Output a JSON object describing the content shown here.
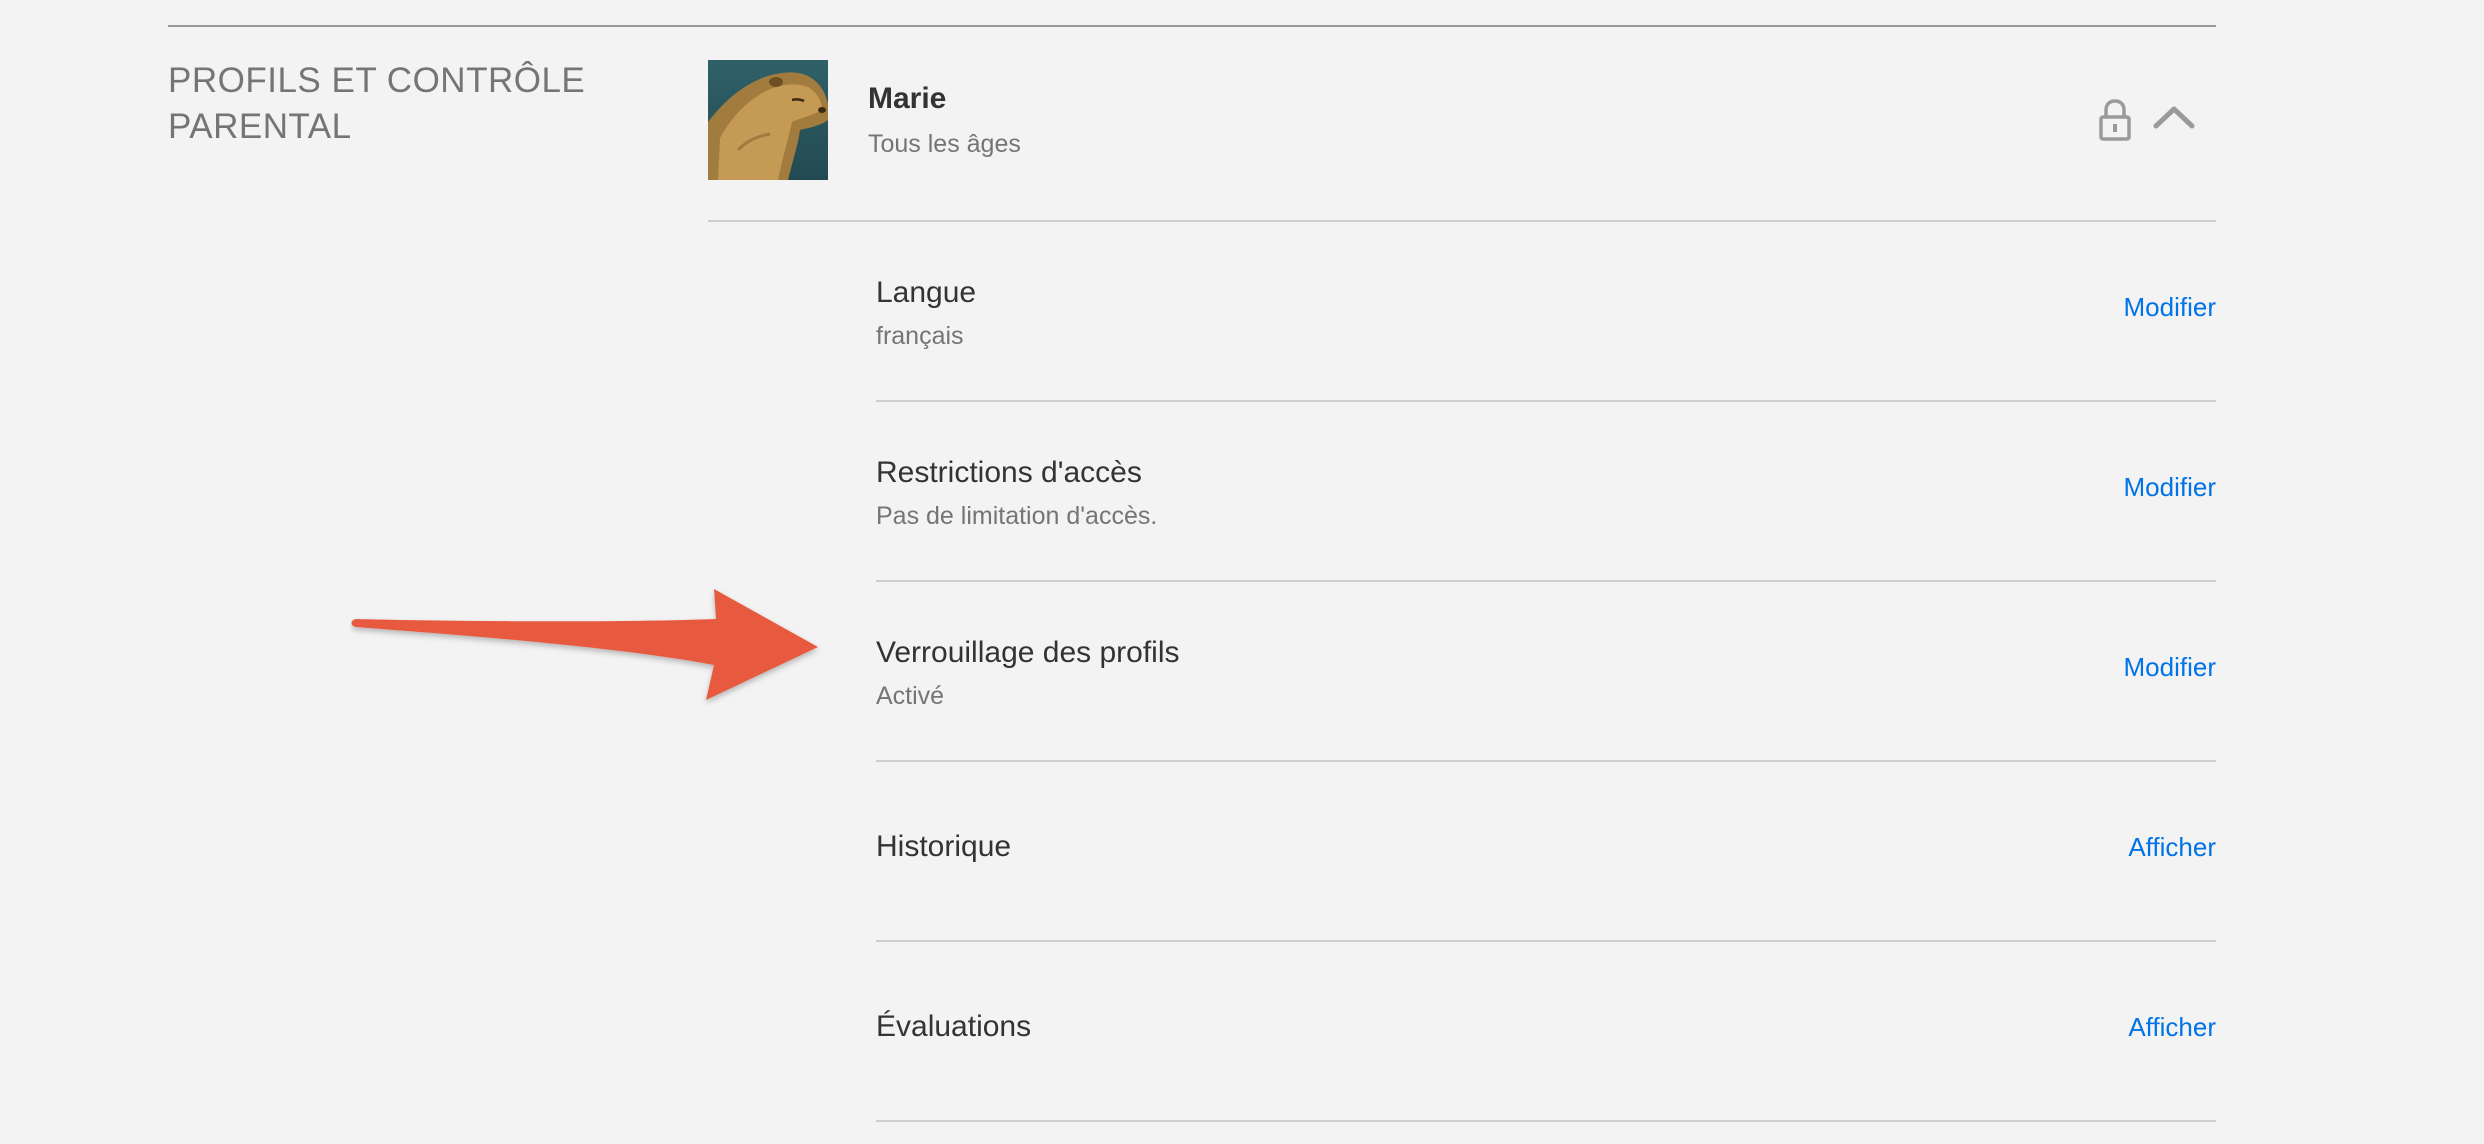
{
  "section": {
    "title": "PROFILS ET CONTRÔLE PARENTAL"
  },
  "profile": {
    "name": "Marie",
    "maturity": "Tous les âges",
    "icons": {
      "lock": "lock-icon",
      "collapse": "chevron-up-icon"
    }
  },
  "settings": [
    {
      "title": "Langue",
      "value": "français",
      "action": "Modifier"
    },
    {
      "title": "Restrictions d'accès",
      "value": "Pas de limitation d'accès.",
      "action": "Modifier"
    },
    {
      "title": "Verrouillage des profils",
      "value": "Activé",
      "action": "Modifier"
    },
    {
      "title": "Historique",
      "value": "",
      "action": "Afficher"
    },
    {
      "title": "Évaluations",
      "value": "",
      "action": "Afficher"
    }
  ],
  "colors": {
    "background": "#f3f3f3",
    "link": "#0073e6",
    "annotation_arrow": "#e85a3f",
    "muted_text": "#757575"
  }
}
